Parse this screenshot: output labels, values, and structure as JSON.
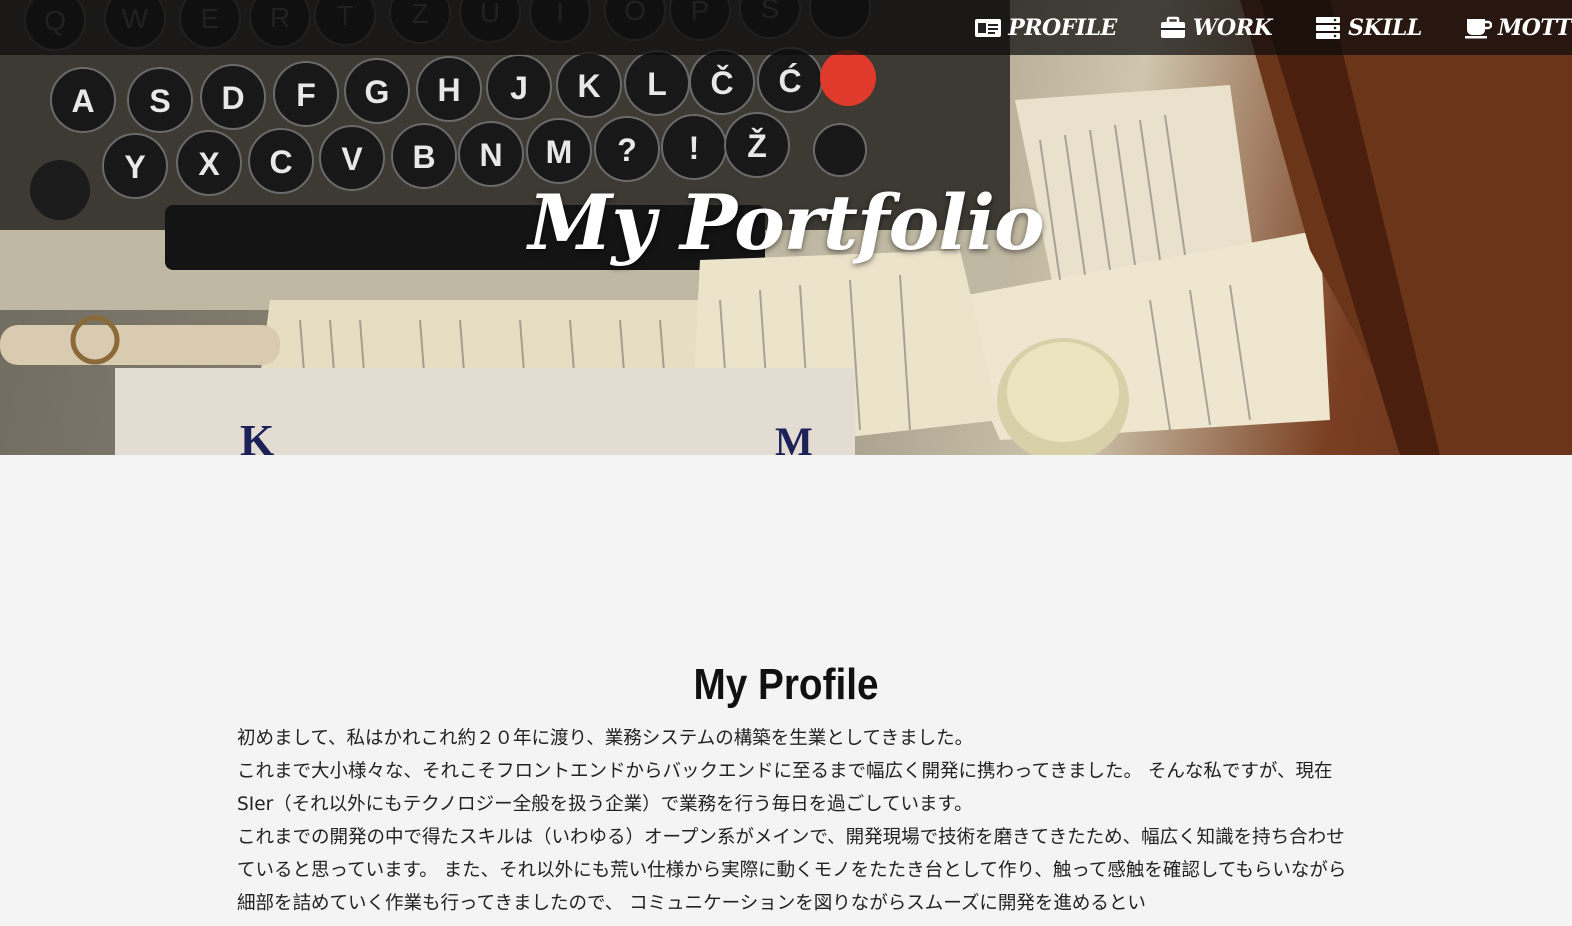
{
  "hero": {
    "title": "My Portfolio"
  },
  "nav": {
    "items": [
      {
        "label": "PROFILE",
        "icon": "id-card-icon"
      },
      {
        "label": "WORK",
        "icon": "briefcase-icon"
      },
      {
        "label": "SKILL",
        "icon": "server-icon"
      },
      {
        "label": "MOTTO",
        "icon": "coffee-cup-icon"
      }
    ]
  },
  "profile": {
    "heading": "My Profile",
    "paragraphs": [
      "初めまして、私はかれこれ約２０年に渡り、業務システムの構築を生業としてきました。",
      "これまで大小様々な、それこそフロントエンドからバックエンドに至るまで幅広く開発に携わってきました。 そんな私ですが、現在SIer（それ以外にもテクノロジー全般を扱う企業）で業務を行う毎日を過ごしています。",
      "これまでの開発の中で得たスキルは（いわゆる）オープン系がメインで、開発現場で技術を磨きてきたため、幅広く知識を持ち合わせていると思っています。 また、それ以外にも荒い仕様から実際に動くモノをたたき台として作り、触って感触を確認してもらいながら細部を詰めていく作業も行ってきましたので、 コミュニケーションを図りながらスムーズに開発を進めるとい"
    ]
  },
  "colors": {
    "nav_background": "#0c0c0c",
    "page_background": "#f4f4f4",
    "text": "#222222"
  }
}
